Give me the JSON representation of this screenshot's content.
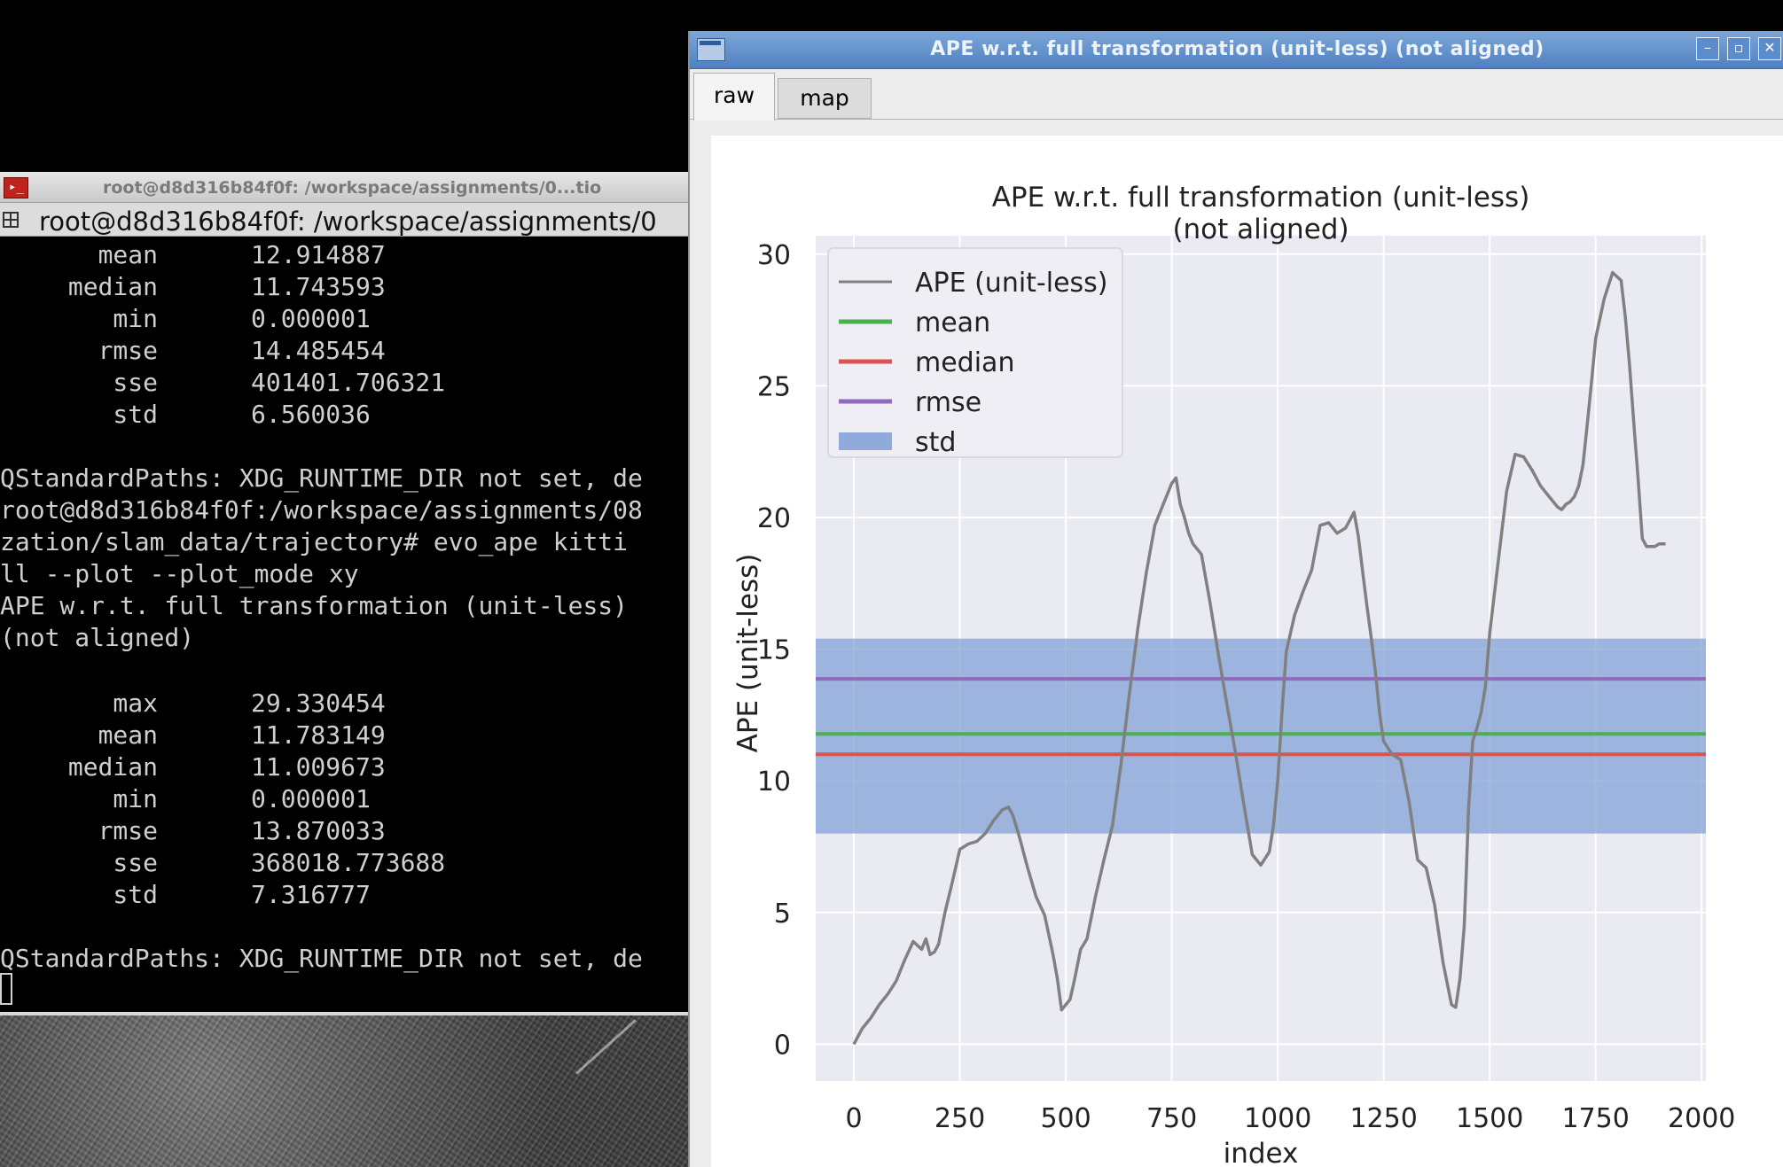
{
  "terminal": {
    "title": "root@d8d316b84f0f: /workspace/assignments/0...tio",
    "tab_title": "root@d8d316b84f0f: /workspace/assignments/0",
    "stats_block_1": [
      {
        "label": "mean",
        "value": "12.914887"
      },
      {
        "label": "median",
        "value": "11.743593"
      },
      {
        "label": "min",
        "value": "0.000001"
      },
      {
        "label": "rmse",
        "value": "14.485454"
      },
      {
        "label": "sse",
        "value": "401401.706321"
      },
      {
        "label": "std",
        "value": "6.560036"
      }
    ],
    "lines": [
      "QStandardPaths: XDG_RUNTIME_DIR not set, de",
      "root@d8d316b84f0f:/workspace/assignments/08",
      "zation/slam_data/trajectory# evo_ape kitti",
      "ll --plot --plot_mode xy",
      "APE w.r.t. full transformation (unit-less)",
      "(not aligned)"
    ],
    "stats_block_2": [
      {
        "label": "max",
        "value": "29.330454"
      },
      {
        "label": "mean",
        "value": "11.783149"
      },
      {
        "label": "median",
        "value": "11.009673"
      },
      {
        "label": "min",
        "value": "0.000001"
      },
      {
        "label": "rmse",
        "value": "13.870033"
      },
      {
        "label": "sse",
        "value": "368018.773688"
      },
      {
        "label": "std",
        "value": "7.316777"
      }
    ],
    "last_line": "QStandardPaths: XDG_RUNTIME_DIR not set, de"
  },
  "plot_window": {
    "title": "APE w.r.t. full transformation (unit-less) (not aligned)",
    "tabs": [
      "raw",
      "map"
    ],
    "active_tab": "raw",
    "buttons": {
      "minimize": "–",
      "maximize": "▫",
      "close": "✕"
    }
  },
  "chart_data": {
    "type": "line",
    "title": "APE w.r.t. full transformation (unit-less)",
    "subtitle": "(not aligned)",
    "xlabel": "index",
    "ylabel": "APE (unit-less)",
    "xlim": [
      -90,
      2010
    ],
    "ylim": [
      -1.4,
      30.7
    ],
    "xticks": [
      0,
      250,
      500,
      750,
      1000,
      1250,
      1500,
      1750,
      2000
    ],
    "yticks": [
      0,
      5,
      10,
      15,
      20,
      25,
      30
    ],
    "grid": true,
    "legend_position": "top-left",
    "colors": {
      "ape": "#808080",
      "mean": "#4caf50",
      "median": "#d9534f",
      "rmse": "#8e6bbf",
      "std": "#7f9fd6",
      "plot_bg": "#eaeaf2"
    },
    "series": [
      {
        "name": "APE (unit-less)",
        "x": [
          0,
          20,
          40,
          60,
          80,
          100,
          120,
          140,
          160,
          170,
          180,
          190,
          200,
          215,
          230,
          250,
          270,
          290,
          310,
          330,
          350,
          365,
          375,
          390,
          410,
          430,
          450,
          470,
          480,
          490,
          500,
          510,
          520,
          535,
          550,
          570,
          590,
          610,
          630,
          650,
          670,
          690,
          710,
          730,
          750,
          760,
          770,
          780,
          790,
          800,
          820,
          840,
          860,
          880,
          900,
          920,
          940,
          960,
          980,
          990,
          1000,
          1010,
          1020,
          1040,
          1060,
          1080,
          1100,
          1120,
          1140,
          1160,
          1180,
          1190,
          1200,
          1210,
          1220,
          1230,
          1240,
          1250,
          1270,
          1290,
          1310,
          1330,
          1350,
          1370,
          1390,
          1410,
          1420,
          1430,
          1440,
          1445,
          1450,
          1460,
          1470,
          1480,
          1490,
          1500,
          1520,
          1540,
          1560,
          1580,
          1600,
          1620,
          1635,
          1650,
          1660,
          1670,
          1680,
          1690,
          1700,
          1710,
          1720,
          1730,
          1740,
          1750,
          1770,
          1790,
          1810,
          1820,
          1830,
          1840,
          1850,
          1860,
          1870,
          1880,
          1890,
          1900,
          1910,
          1915
        ],
        "values": [
          0.0,
          0.6,
          1.0,
          1.5,
          1.9,
          2.4,
          3.2,
          3.9,
          3.6,
          4.0,
          3.4,
          3.5,
          3.8,
          5.0,
          6.0,
          7.4,
          7.6,
          7.7,
          8.0,
          8.5,
          8.9,
          9.0,
          8.7,
          7.9,
          6.7,
          5.6,
          4.9,
          3.4,
          2.5,
          1.3,
          1.5,
          1.7,
          2.4,
          3.6,
          4.0,
          5.6,
          7.0,
          8.3,
          10.6,
          13.3,
          15.8,
          17.9,
          19.7,
          20.5,
          21.3,
          21.5,
          20.5,
          20.0,
          19.4,
          19.0,
          18.6,
          16.8,
          14.8,
          12.9,
          11.1,
          9.1,
          7.2,
          6.8,
          7.3,
          8.3,
          10.0,
          12.6,
          14.9,
          16.3,
          17.2,
          18.0,
          19.7,
          19.8,
          19.4,
          19.6,
          20.2,
          19.3,
          18.0,
          16.7,
          15.5,
          14.2,
          12.6,
          11.5,
          11.0,
          10.8,
          9.2,
          7.0,
          6.7,
          5.3,
          3.1,
          1.5,
          1.4,
          2.5,
          4.5,
          6.6,
          8.9,
          11.5,
          12.0,
          12.6,
          13.6,
          15.6,
          18.3,
          21.0,
          22.4,
          22.3,
          21.8,
          21.2,
          20.9,
          20.6,
          20.4,
          20.3,
          20.5,
          20.6,
          20.8,
          21.2,
          22.0,
          23.5,
          25.1,
          26.8,
          28.3,
          29.3,
          29.0,
          27.6,
          25.8,
          23.6,
          21.5,
          19.2,
          18.9,
          18.9,
          18.9,
          19.0,
          19.0,
          19.0
        ]
      },
      {
        "name": "mean",
        "value": 11.783149
      },
      {
        "name": "median",
        "value": 11.009673
      },
      {
        "name": "rmse",
        "value": 13.870033
      },
      {
        "name": "std",
        "range": [
          8.0,
          15.4
        ]
      }
    ]
  }
}
